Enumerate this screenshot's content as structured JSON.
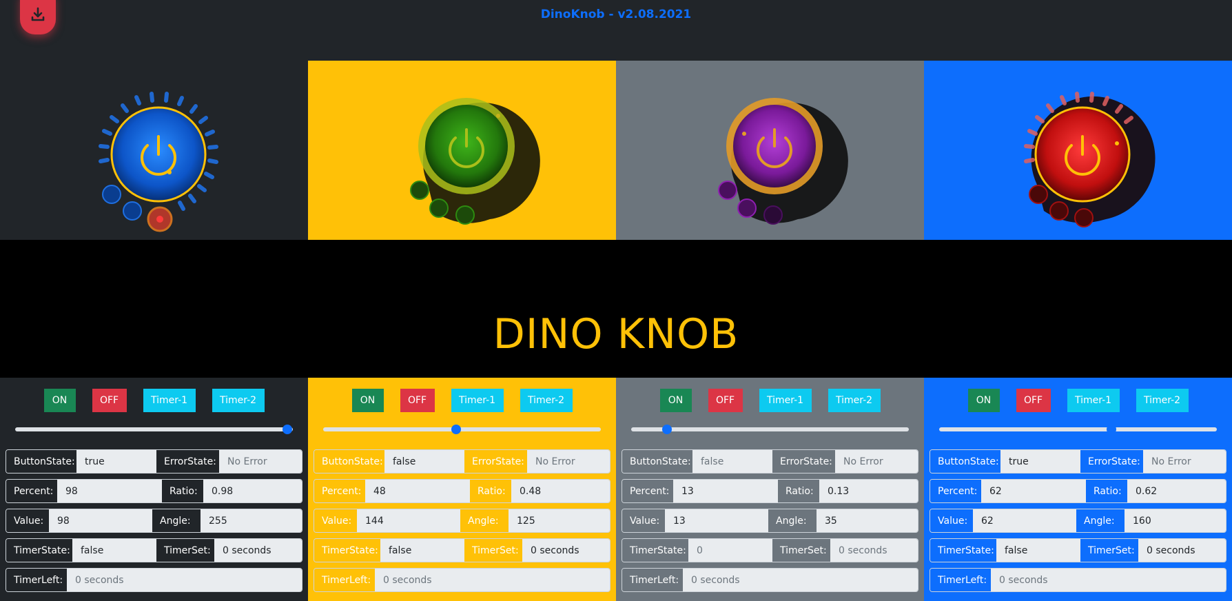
{
  "app": {
    "title": "DinoKnob - v2.08.2021",
    "banner_title": "DINO KNOB"
  },
  "header": {
    "download_icon": "download-icon"
  },
  "colors": {
    "dark": "#212529",
    "yellow": "#ffc107",
    "grey": "#6c757d",
    "blue": "#0d6efd",
    "green": "#198754",
    "red": "#dc3545",
    "cyan": "#0dcaf0"
  },
  "knobs": [
    {
      "panel_bg": "#212529",
      "core": "#0d6efd",
      "ring": "#ffc107",
      "icon": "power-icon"
    },
    {
      "panel_bg": "#ffc107",
      "core": "#2e8b10",
      "ring": "#aabf1a",
      "icon": "power-icon"
    },
    {
      "panel_bg": "#6c757d",
      "core": "#8e1fb0",
      "ring": "#e39b28",
      "icon": "power-icon"
    },
    {
      "panel_bg": "#0d6efd",
      "core": "#d41616",
      "ring": "#ffc107",
      "icon": "power-icon"
    }
  ],
  "buttons": {
    "on": "ON",
    "off": "OFF",
    "timer1": "Timer-1",
    "timer2": "Timer-2"
  },
  "labels": {
    "button_state": "ButtonState:",
    "error_state": "ErrorState:",
    "percent": "Percent:",
    "ratio": "Ratio:",
    "value": "Value:",
    "angle": "Angle:",
    "timer_state": "TimerState:",
    "timer_set": "TimerSet:",
    "timer_left": "TimerLeft:"
  },
  "panels": [
    {
      "slider_percent": 98,
      "button_state": "true",
      "error_state": "No Error",
      "percent": "98",
      "ratio": "0.98",
      "value": "98",
      "angle": "255",
      "timer_state": "false",
      "timer_set": "0 seconds",
      "timer_left": "0 seconds"
    },
    {
      "slider_percent": 48,
      "button_state": "false",
      "error_state": "No Error",
      "percent": "48",
      "ratio": "0.48",
      "value": "144",
      "angle": "125",
      "timer_state": "false",
      "timer_set": "0 seconds",
      "timer_left": "0 seconds"
    },
    {
      "slider_percent": 13,
      "button_state": "false",
      "error_state": "No Error",
      "percent": "13",
      "ratio": "0.13",
      "value": "13",
      "angle": "35",
      "timer_state": "0",
      "timer_set": "0 seconds",
      "timer_left": "0 seconds"
    },
    {
      "slider_percent": 62,
      "button_state": "true",
      "error_state": "No Error",
      "percent": "62",
      "ratio": "0.62",
      "value": "62",
      "angle": "160",
      "timer_state": "false",
      "timer_set": "0 seconds",
      "timer_left": "0 seconds"
    }
  ]
}
